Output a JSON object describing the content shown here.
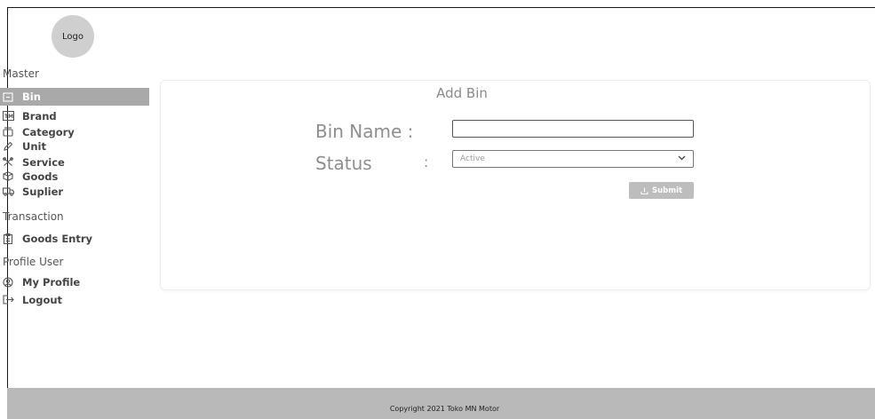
{
  "logo": {
    "label": "Logo"
  },
  "sidebar": {
    "master_heading": "Master",
    "master_items": [
      {
        "label": "Bin",
        "icon": "bin-icon",
        "active": true
      },
      {
        "label": "Brand",
        "icon": "trademark-icon"
      },
      {
        "label": "Category",
        "icon": "category-icon"
      },
      {
        "label": "Unit",
        "icon": "pencil-icon"
      },
      {
        "label": "Service",
        "icon": "tools-icon"
      },
      {
        "label": "Goods",
        "icon": "box-icon"
      },
      {
        "label": "Suplier",
        "icon": "truck-icon"
      }
    ],
    "transaction_heading": "Transaction",
    "transaction_items": [
      {
        "label": "Goods Entry",
        "icon": "clipboard-icon"
      }
    ],
    "profile_heading": "Profile User",
    "profile_items": [
      {
        "label": "My Profile",
        "icon": "user-circle-icon"
      },
      {
        "label": "Logout",
        "icon": "logout-icon"
      }
    ]
  },
  "form": {
    "title": "Add Bin",
    "bin_name_label": "Bin Name :",
    "bin_name_value": "",
    "status_label": "Status",
    "status_colon": ":",
    "status_value": "Active",
    "submit_label": "Submit"
  },
  "footer": {
    "copyright": "Copyright 2021 Toko MN Motor"
  },
  "colors": {
    "active_item_bg": "#a9a9a9",
    "footer_bg": "#b9b9b9",
    "submit_bg": "#bdbdbd"
  }
}
